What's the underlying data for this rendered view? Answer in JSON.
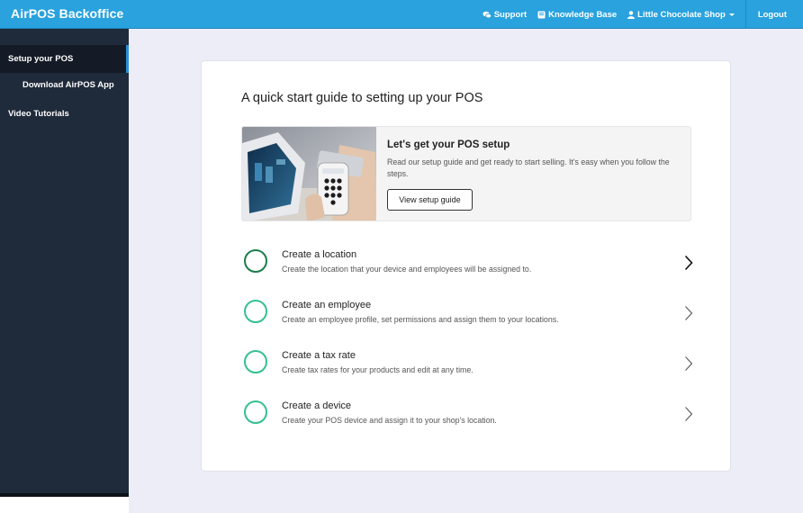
{
  "header": {
    "brand": "AirPOS Backoffice",
    "support": "Support",
    "knowledge_base": "Knowledge Base",
    "shop": "Little Chocolate Shop",
    "logout": "Logout",
    "bar_color": "#29a2de"
  },
  "sidebar": {
    "items": [
      {
        "label": "Setup your POS",
        "state": "active"
      },
      {
        "label": "Download AirPOS App"
      },
      {
        "label": "Video Tutorials"
      }
    ]
  },
  "main": {
    "title": "A quick start guide to setting up your POS",
    "banner": {
      "title": "Let's get your POS setup",
      "description": "Read our setup guide and get ready to start selling. It's easy when you follow the steps.",
      "button": "View setup guide"
    },
    "steps": [
      {
        "title": "Create a location",
        "description": "Create the location that your device and employees will be assigned to."
      },
      {
        "title": "Create an employee",
        "description": "Create an employee profile, set permissions and assign them to your locations."
      },
      {
        "title": "Create a tax rate",
        "description": "Create tax rates for your products and edit at any time."
      },
      {
        "title": "Create a device",
        "description": "Create your POS device and assign it to your shop's location."
      }
    ],
    "accent_color": "#34c08f"
  }
}
